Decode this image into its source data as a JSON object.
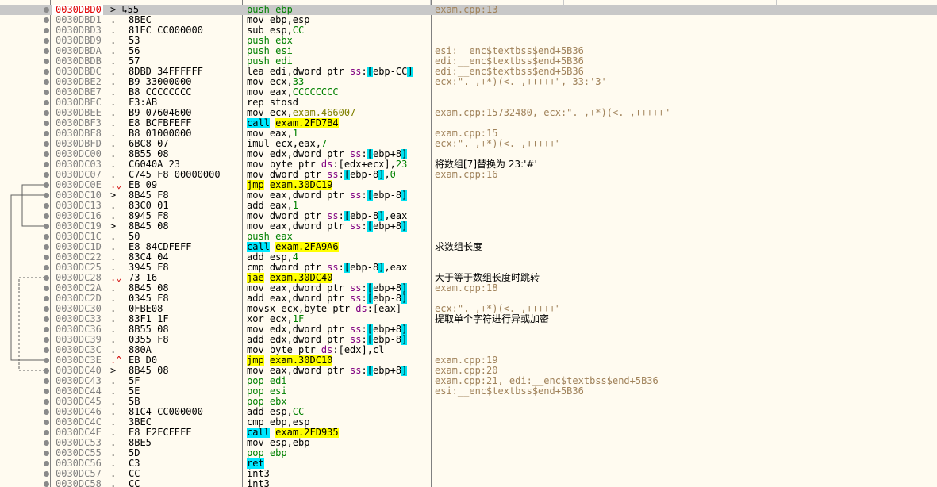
{
  "rows": [
    {
      "addr": "0030DBD0",
      "mark": "> ↳55",
      "bytes": "",
      "ins": [
        {
          "t": "push ",
          "c": "kw-stack"
        },
        {
          "t": "ebp",
          "c": "kw-stack"
        }
      ],
      "cmt": "exam.cpp:13",
      "sel": true
    },
    {
      "addr": "0030DBD1",
      "mark": ".",
      "bytes": "8BEC",
      "ins": [
        {
          "t": "mov ebp,esp"
        }
      ],
      "cmt": ""
    },
    {
      "addr": "0030DBD3",
      "mark": ".",
      "bytes": "81EC CC000000",
      "ins": [
        {
          "t": "sub esp,"
        },
        {
          "t": "CC",
          "c": "num"
        }
      ],
      "cmt": ""
    },
    {
      "addr": "0030DBD9",
      "mark": ".",
      "bytes": "53",
      "ins": [
        {
          "t": "push ebx",
          "c": "kw-stack"
        }
      ],
      "cmt": ""
    },
    {
      "addr": "0030DBDA",
      "mark": ".",
      "bytes": "56",
      "ins": [
        {
          "t": "push esi",
          "c": "kw-stack"
        }
      ],
      "cmt": "esi:__enc$textbss$end+5B36"
    },
    {
      "addr": "0030DBDB",
      "mark": ".",
      "bytes": "57",
      "ins": [
        {
          "t": "push edi",
          "c": "kw-stack"
        }
      ],
      "cmt": "edi:__enc$textbss$end+5B36"
    },
    {
      "addr": "0030DBDC",
      "mark": ".",
      "bytes": "8DBD 34FFFFFF",
      "ins": [
        {
          "t": "lea edi,dword ptr "
        },
        {
          "t": "ss",
          "c": "seg"
        },
        {
          "t": ":"
        },
        {
          "t": "[",
          "c": "mem"
        },
        {
          "t": "ebp-CC"
        },
        {
          "t": "]",
          "c": "mem"
        }
      ],
      "cmt": "edi:__enc$textbss$end+5B36"
    },
    {
      "addr": "0030DBE2",
      "mark": ".",
      "bytes": "B9 33000000",
      "ins": [
        {
          "t": "mov ecx,"
        },
        {
          "t": "33",
          "c": "num"
        }
      ],
      "cmt": "ecx:\".-,+*)(<.-,+++++\", 33:'3'"
    },
    {
      "addr": "0030DBE7",
      "mark": ".",
      "bytes": "B8 CCCCCCCC",
      "ins": [
        {
          "t": "mov eax,"
        },
        {
          "t": "CCCCCCCC",
          "c": "num"
        }
      ],
      "cmt": ""
    },
    {
      "addr": "0030DBEC",
      "mark": ".",
      "bytes": "F3:AB",
      "ins": [
        {
          "t": "rep stosd"
        }
      ],
      "cmt": ""
    },
    {
      "addr": "0030DBEE",
      "mark": ".",
      "bytes": "B9 07604600",
      "bytes_u": true,
      "ins": [
        {
          "t": "mov ecx,"
        },
        {
          "t": "exam.466007",
          "c": "sym"
        }
      ],
      "cmt": "exam.cpp:15732480, ecx:\".-,+*)(<.-,+++++\""
    },
    {
      "addr": "0030DBF3",
      "mark": ".",
      "bytes": "E8 BCFBFEFF",
      "ins": [
        {
          "t": "call",
          "c": "kw-call"
        },
        {
          "t": " "
        },
        {
          "t": "exam.2FD7B4",
          "c": "kw-jmp"
        }
      ],
      "cmt": ""
    },
    {
      "addr": "0030DBF8",
      "mark": ".",
      "bytes": "B8 01000000",
      "ins": [
        {
          "t": "mov eax,"
        },
        {
          "t": "1",
          "c": "num"
        }
      ],
      "cmt": "exam.cpp:15"
    },
    {
      "addr": "0030DBFD",
      "mark": ".",
      "bytes": "6BC8 07",
      "ins": [
        {
          "t": "imul ecx,eax,"
        },
        {
          "t": "7",
          "c": "num"
        }
      ],
      "cmt": "ecx:\".-,+*)(<.-,+++++\""
    },
    {
      "addr": "0030DC00",
      "mark": ".",
      "bytes": "8B55 08",
      "ins": [
        {
          "t": "mov edx,dword ptr "
        },
        {
          "t": "ss",
          "c": "seg"
        },
        {
          "t": ":"
        },
        {
          "t": "[",
          "c": "mem"
        },
        {
          "t": "ebp+8"
        },
        {
          "t": "]",
          "c": "mem"
        }
      ],
      "cmt": ""
    },
    {
      "addr": "0030DC03",
      "mark": ".",
      "bytes": "C6040A 23",
      "ins": [
        {
          "t": "mov byte ptr "
        },
        {
          "t": "ds",
          "c": "seg"
        },
        {
          "t": ":[edx+ecx],"
        },
        {
          "t": "23",
          "c": "num"
        }
      ],
      "cmt": "将数组[7]替换为 23:'#'",
      "cn": true
    },
    {
      "addr": "0030DC07",
      "mark": ".",
      "bytes": "C745 F8 00000000",
      "ins": [
        {
          "t": "mov dword ptr "
        },
        {
          "t": "ss",
          "c": "seg"
        },
        {
          "t": ":"
        },
        {
          "t": "[",
          "c": "mem"
        },
        {
          "t": "ebp-8"
        },
        {
          "t": "]",
          "c": "mem"
        },
        {
          "t": ","
        },
        {
          "t": "0",
          "c": "num"
        }
      ],
      "cmt": "exam.cpp:16"
    },
    {
      "addr": "0030DC0E",
      "mark": ".⌄",
      "bytes": "EB 09",
      "ins": [
        {
          "t": "jmp",
          "c": "kw-jmp"
        },
        {
          "t": " "
        },
        {
          "t": "exam.30DC19",
          "c": "kw-jmp"
        }
      ],
      "cmt": ""
    },
    {
      "addr": "0030DC10",
      "mark": ">",
      "bytes": "8B45 F8",
      "ins": [
        {
          "t": "mov eax,dword ptr "
        },
        {
          "t": "ss",
          "c": "seg"
        },
        {
          "t": ":"
        },
        {
          "t": "[",
          "c": "mem"
        },
        {
          "t": "ebp-8"
        },
        {
          "t": "]",
          "c": "mem"
        }
      ],
      "cmt": ""
    },
    {
      "addr": "0030DC13",
      "mark": ".",
      "bytes": "83C0 01",
      "ins": [
        {
          "t": "add eax,"
        },
        {
          "t": "1",
          "c": "num"
        }
      ],
      "cmt": ""
    },
    {
      "addr": "0030DC16",
      "mark": ".",
      "bytes": "8945 F8",
      "ins": [
        {
          "t": "mov dword ptr "
        },
        {
          "t": "ss",
          "c": "seg"
        },
        {
          "t": ":"
        },
        {
          "t": "[",
          "c": "mem"
        },
        {
          "t": "ebp-8"
        },
        {
          "t": "]",
          "c": "mem"
        },
        {
          "t": ",eax"
        }
      ],
      "cmt": ""
    },
    {
      "addr": "0030DC19",
      "mark": ">",
      "bytes": "8B45 08",
      "ins": [
        {
          "t": "mov eax,dword ptr "
        },
        {
          "t": "ss",
          "c": "seg"
        },
        {
          "t": ":"
        },
        {
          "t": "[",
          "c": "mem"
        },
        {
          "t": "ebp+8"
        },
        {
          "t": "]",
          "c": "mem"
        }
      ],
      "cmt": ""
    },
    {
      "addr": "0030DC1C",
      "mark": ".",
      "bytes": "50",
      "ins": [
        {
          "t": "push eax",
          "c": "kw-stack"
        }
      ],
      "cmt": ""
    },
    {
      "addr": "0030DC1D",
      "mark": ".",
      "bytes": "E8 84CDFEFF",
      "ins": [
        {
          "t": "call",
          "c": "kw-call"
        },
        {
          "t": " "
        },
        {
          "t": "exam.2FA9A6",
          "c": "kw-jmp"
        }
      ],
      "cmt": "求数组长度",
      "cn": true
    },
    {
      "addr": "0030DC22",
      "mark": ".",
      "bytes": "83C4 04",
      "ins": [
        {
          "t": "add esp,"
        },
        {
          "t": "4",
          "c": "num"
        }
      ],
      "cmt": ""
    },
    {
      "addr": "0030DC25",
      "mark": ".",
      "bytes": "3945 F8",
      "ins": [
        {
          "t": "cmp dword ptr "
        },
        {
          "t": "ss",
          "c": "seg"
        },
        {
          "t": ":"
        },
        {
          "t": "[",
          "c": "mem"
        },
        {
          "t": "ebp-8"
        },
        {
          "t": "]",
          "c": "mem"
        },
        {
          "t": ",eax"
        }
      ],
      "cmt": ""
    },
    {
      "addr": "0030DC28",
      "mark": ".⌄",
      "bytes": "73 16",
      "ins": [
        {
          "t": "jae",
          "c": "kw-jmp"
        },
        {
          "t": " "
        },
        {
          "t": "exam.30DC40",
          "c": "kw-jmp"
        }
      ],
      "cmt": "大于等于数组长度时跳转",
      "cn": true
    },
    {
      "addr": "0030DC2A",
      "mark": ".",
      "bytes": "8B45 08",
      "ins": [
        {
          "t": "mov eax,dword ptr "
        },
        {
          "t": "ss",
          "c": "seg"
        },
        {
          "t": ":"
        },
        {
          "t": "[",
          "c": "mem"
        },
        {
          "t": "ebp+8"
        },
        {
          "t": "]",
          "c": "mem"
        }
      ],
      "cmt": "exam.cpp:18"
    },
    {
      "addr": "0030DC2D",
      "mark": ".",
      "bytes": "0345 F8",
      "ins": [
        {
          "t": "add eax,dword ptr "
        },
        {
          "t": "ss",
          "c": "seg"
        },
        {
          "t": ":"
        },
        {
          "t": "[",
          "c": "mem"
        },
        {
          "t": "ebp-8"
        },
        {
          "t": "]",
          "c": "mem"
        }
      ],
      "cmt": ""
    },
    {
      "addr": "0030DC30",
      "mark": ".",
      "bytes": "0FBE08",
      "ins": [
        {
          "t": "movsx ecx,byte ptr "
        },
        {
          "t": "ds",
          "c": "seg"
        },
        {
          "t": ":[eax]"
        }
      ],
      "cmt": "ecx:\".-,+*)(<.-,+++++\""
    },
    {
      "addr": "0030DC33",
      "mark": ".",
      "bytes": "83F1 1F",
      "ins": [
        {
          "t": "xor ecx,"
        },
        {
          "t": "1F",
          "c": "num"
        }
      ],
      "cmt": "提取单个字符进行异或加密",
      "cn": true
    },
    {
      "addr": "0030DC36",
      "mark": ".",
      "bytes": "8B55 08",
      "ins": [
        {
          "t": "mov edx,dword ptr "
        },
        {
          "t": "ss",
          "c": "seg"
        },
        {
          "t": ":"
        },
        {
          "t": "[",
          "c": "mem"
        },
        {
          "t": "ebp+8"
        },
        {
          "t": "]",
          "c": "mem"
        }
      ],
      "cmt": ""
    },
    {
      "addr": "0030DC39",
      "mark": ".",
      "bytes": "0355 F8",
      "ins": [
        {
          "t": "add edx,dword ptr "
        },
        {
          "t": "ss",
          "c": "seg"
        },
        {
          "t": ":"
        },
        {
          "t": "[",
          "c": "mem"
        },
        {
          "t": "ebp-8"
        },
        {
          "t": "]",
          "c": "mem"
        }
      ],
      "cmt": ""
    },
    {
      "addr": "0030DC3C",
      "mark": ".",
      "bytes": "880A",
      "ins": [
        {
          "t": "mov byte ptr "
        },
        {
          "t": "ds",
          "c": "seg"
        },
        {
          "t": ":[edx],cl"
        }
      ],
      "cmt": ""
    },
    {
      "addr": "0030DC3E",
      "mark": ".^",
      "bytes": "EB D0",
      "ins": [
        {
          "t": "jmp",
          "c": "kw-jmp"
        },
        {
          "t": " "
        },
        {
          "t": "exam.30DC10",
          "c": "kw-jmp"
        }
      ],
      "cmt": "exam.cpp:19"
    },
    {
      "addr": "0030DC40",
      "mark": ">",
      "bytes": "8B45 08",
      "ins": [
        {
          "t": "mov eax,dword ptr "
        },
        {
          "t": "ss",
          "c": "seg"
        },
        {
          "t": ":"
        },
        {
          "t": "[",
          "c": "mem"
        },
        {
          "t": "ebp+8"
        },
        {
          "t": "]",
          "c": "mem"
        }
      ],
      "cmt": "exam.cpp:20"
    },
    {
      "addr": "0030DC43",
      "mark": ".",
      "bytes": "5F",
      "ins": [
        {
          "t": "pop edi",
          "c": "kw-stack"
        }
      ],
      "cmt": "exam.cpp:21, edi:__enc$textbss$end+5B36"
    },
    {
      "addr": "0030DC44",
      "mark": ".",
      "bytes": "5E",
      "ins": [
        {
          "t": "pop esi",
          "c": "kw-stack"
        }
      ],
      "cmt": "esi:__enc$textbss$end+5B36"
    },
    {
      "addr": "0030DC45",
      "mark": ".",
      "bytes": "5B",
      "ins": [
        {
          "t": "pop ebx",
          "c": "kw-stack"
        }
      ],
      "cmt": ""
    },
    {
      "addr": "0030DC46",
      "mark": ".",
      "bytes": "81C4 CC000000",
      "ins": [
        {
          "t": "add esp,"
        },
        {
          "t": "CC",
          "c": "num"
        }
      ],
      "cmt": ""
    },
    {
      "addr": "0030DC4C",
      "mark": ".",
      "bytes": "3BEC",
      "ins": [
        {
          "t": "cmp ebp,esp"
        }
      ],
      "cmt": ""
    },
    {
      "addr": "0030DC4E",
      "mark": ".",
      "bytes": "E8 E2FCFEFF",
      "ins": [
        {
          "t": "call",
          "c": "kw-call"
        },
        {
          "t": " "
        },
        {
          "t": "exam.2FD935",
          "c": "kw-jmp"
        }
      ],
      "cmt": ""
    },
    {
      "addr": "0030DC53",
      "mark": ".",
      "bytes": "8BE5",
      "ins": [
        {
          "t": "mov esp,ebp"
        }
      ],
      "cmt": ""
    },
    {
      "addr": "0030DC55",
      "mark": ".",
      "bytes": "5D",
      "ins": [
        {
          "t": "pop ebp",
          "c": "kw-stack"
        }
      ],
      "cmt": ""
    },
    {
      "addr": "0030DC56",
      "mark": ".",
      "bytes": "C3",
      "ins": [
        {
          "t": "ret",
          "c": "kw-ret"
        }
      ],
      "cmt": ""
    },
    {
      "addr": "0030DC57",
      "mark": ".",
      "bytes": "CC",
      "ins": [
        {
          "t": "int3"
        }
      ],
      "cmt": ""
    },
    {
      "addr": "0030DC58",
      "mark": ".",
      "bytes": "CC",
      "ins": [
        {
          "t": "int3"
        }
      ],
      "cmt": ""
    }
  ]
}
